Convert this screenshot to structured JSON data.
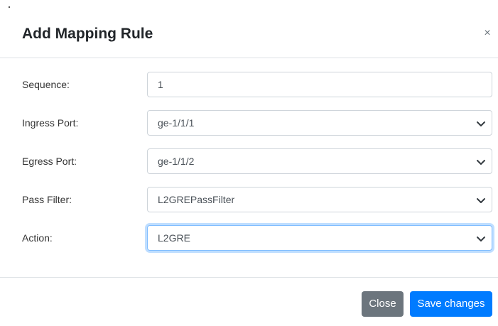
{
  "dialog": {
    "title": "Add Mapping Rule",
    "close_symbol": "×"
  },
  "form": {
    "sequence": {
      "label": "Sequence:",
      "value": "1"
    },
    "ingress_port": {
      "label": "Ingress Port:",
      "value": "ge-1/1/1"
    },
    "egress_port": {
      "label": "Egress Port:",
      "value": "ge-1/1/2"
    },
    "pass_filter": {
      "label": "Pass Filter:",
      "value": "L2GREPassFilter"
    },
    "action": {
      "label": "Action:",
      "value": "L2GRE"
    }
  },
  "footer": {
    "close_label": "Close",
    "save_label": "Save changes"
  },
  "icons": {
    "close": "close-icon",
    "dropdown": "chevron-down-icon"
  },
  "colors": {
    "primary": "#007bff",
    "secondary": "#6c757d",
    "focus_border": "#80bdff",
    "divider": "#dee2e6"
  }
}
